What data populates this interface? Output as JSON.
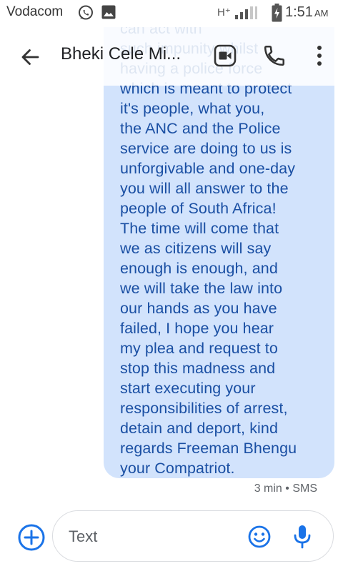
{
  "status_bar": {
    "carrier": "Vodacom",
    "network_type": "H⁺",
    "time": "1:51",
    "ampm": "AM",
    "icons": [
      "whatsapp-icon",
      "gallery-icon",
      "signal-icon",
      "battery-icon"
    ]
  },
  "toolbar": {
    "contact_name": "Bheki Cele Mi...",
    "icons": [
      "back-arrow-icon",
      "video-call-icon",
      "phone-icon",
      "more-vert-icon"
    ]
  },
  "message": {
    "text": "Its a disgrace that foreigners can act with\nsuch impunity whilst\nhaving a police force\nwhich is meant to protect\nit's people, what you,\nthe ANC and the Police\nservice are doing to us is\nunforgivable and one-day\nyou will all answer to the\npeople of South Africa!\nThe time will come that\nwe as citizens will say\nenough is enough, and\nwe will take the law into\nour hands as you have\nfailed, I hope you hear\nmy plea and request to\nstop this madness and\nstart executing your\nresponsibilities of arrest,\ndetain and deport, kind\nregards Freeman Bhengu\nyour Compatriot.",
    "meta": "3 min • SMS"
  },
  "compose": {
    "placeholder": "Text",
    "value": "",
    "icons": [
      "add-circle-icon",
      "emoji-icon",
      "mic-icon"
    ]
  },
  "colors": {
    "bubble": "#d2e3fc",
    "bubble_text": "#1a4fa3",
    "accent": "#1a73e8"
  }
}
